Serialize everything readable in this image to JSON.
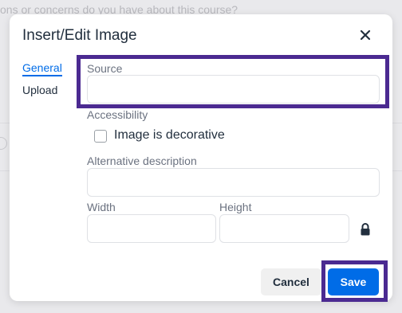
{
  "background": {
    "prompt_text": "ons or concerns do you have about this course?"
  },
  "dialog": {
    "title": "Insert/Edit Image",
    "close_icon": "close-icon"
  },
  "tabs": [
    {
      "label": "General",
      "active": true
    },
    {
      "label": "Upload",
      "active": false
    }
  ],
  "form": {
    "source_label": "Source",
    "source_value": "",
    "accessibility_label": "Accessibility",
    "decorative_label": "Image is decorative",
    "decorative_checked": false,
    "alt_label": "Alternative description",
    "alt_value": "",
    "width_label": "Width",
    "width_value": "",
    "height_label": "Height",
    "height_value": "",
    "lock_icon": "lock-icon"
  },
  "buttons": {
    "cancel_label": "Cancel",
    "save_label": "Save"
  },
  "colors": {
    "accent": "#006ce7",
    "highlight": "#4b2a91",
    "text": "#222f3e"
  }
}
